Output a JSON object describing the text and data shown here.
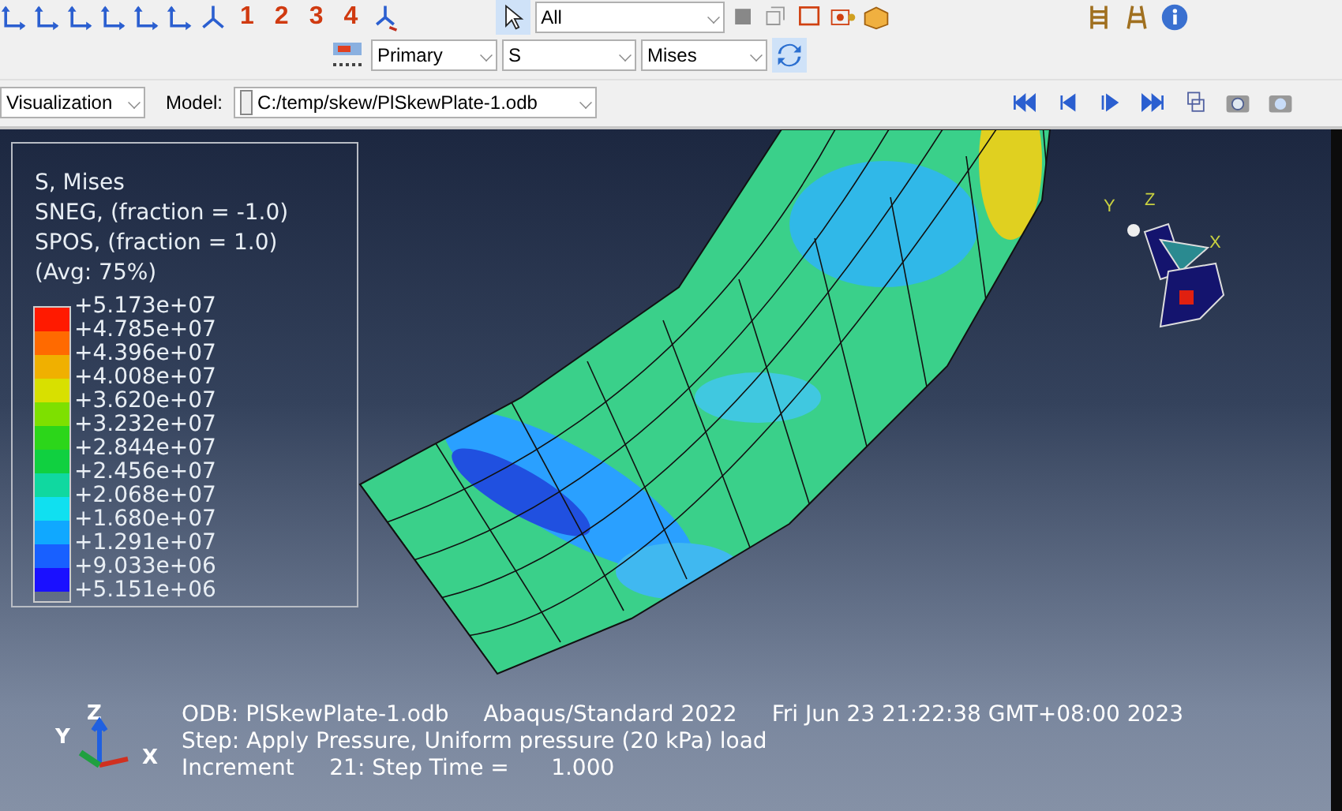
{
  "toolbar": {
    "view_buttons": [
      "1",
      "2",
      "3",
      "4"
    ],
    "selection_filter": "All",
    "field_output": {
      "variable_type": "Primary",
      "variable": "S",
      "component": "Mises"
    },
    "module": "Visualization",
    "model_label": "Model:",
    "model_path": "C:/temp/skew/PlSkewPlate-1.odb"
  },
  "legend": {
    "lines": [
      "S, Mises",
      "SNEG, (fraction = -1.0)",
      "SPOS, (fraction = 1.0)",
      "(Avg: 75%)"
    ],
    "bands": [
      {
        "color": "#ff1a00"
      },
      {
        "color": "#ff6a00"
      },
      {
        "color": "#f0b000"
      },
      {
        "color": "#d8e000"
      },
      {
        "color": "#7ee000"
      },
      {
        "color": "#2cd61a"
      },
      {
        "color": "#10d040"
      },
      {
        "color": "#10d8a0"
      },
      {
        "color": "#10e0f0"
      },
      {
        "color": "#10a8ff"
      },
      {
        "color": "#1860ff"
      },
      {
        "color": "#1a10ff"
      }
    ],
    "values": [
      "+5.173e+07",
      "+4.785e+07",
      "+4.396e+07",
      "+4.008e+07",
      "+3.620e+07",
      "+3.232e+07",
      "+2.844e+07",
      "+2.456e+07",
      "+2.068e+07",
      "+1.680e+07",
      "+1.291e+07",
      "+9.033e+06",
      "+5.151e+06"
    ]
  },
  "view_triad": {
    "labels": [
      "Y",
      "Z",
      "X"
    ]
  },
  "axes_triad": {
    "labels": [
      "Y",
      "Z",
      "X"
    ]
  },
  "info": {
    "odb": "ODB: PlSkewPlate-1.odb",
    "solver": "Abaqus/Standard 2022",
    "date": "Fri Jun 23 21:22:38 GMT+08:00 2023",
    "step": "Step: Apply Pressure, Uniform pressure (20 kPa) load",
    "increment": "Increment     21: Step Time =      1.000"
  }
}
